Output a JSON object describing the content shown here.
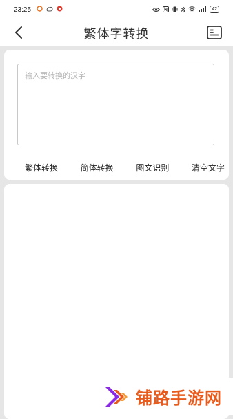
{
  "status_bar": {
    "time": "23:25",
    "battery": "42",
    "left_icons": [
      "notification-icon",
      "weather-icon",
      "app-notification-icon"
    ],
    "right_icons": [
      "eye-icon",
      "nfc-icon",
      "vibrate-icon",
      "bluetooth-icon",
      "wifi-icon",
      "signal-icon"
    ]
  },
  "app_bar": {
    "title": "繁体字转换",
    "back_icon": "chevron-left-icon",
    "menu_icon": "list-card-icon"
  },
  "input": {
    "placeholder": "输入要转换的汉字",
    "value": ""
  },
  "actions": {
    "traditional": "繁体转换",
    "simplified": "简体转换",
    "ocr": "图文识别",
    "clear": "清空文字"
  },
  "output": {
    "text": ""
  },
  "watermark": {
    "text": "铺路手游网",
    "color": "#e75b1d"
  },
  "colors": {
    "background": "#e6e6e6",
    "card": "#ffffff",
    "accent": "#e75b1d",
    "logo_purple": "#8a2be2"
  }
}
